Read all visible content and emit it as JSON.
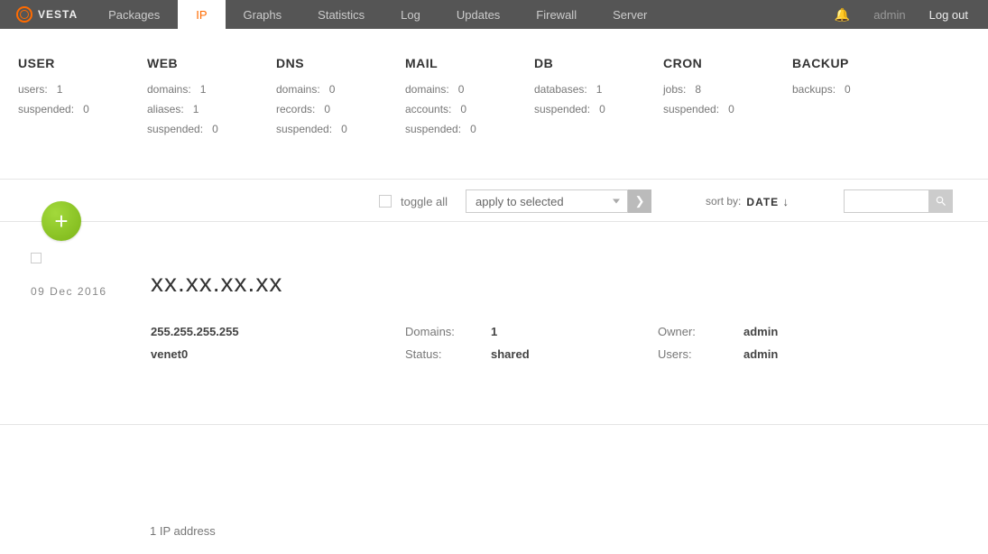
{
  "brand": "VESTA",
  "nav": {
    "items": [
      "Packages",
      "IP",
      "Graphs",
      "Statistics",
      "Log",
      "Updates",
      "Firewall",
      "Server"
    ],
    "active_index": 1
  },
  "topright": {
    "user": "admin",
    "logout": "Log out"
  },
  "stats": [
    {
      "title": "USER",
      "rows": [
        {
          "label": "users:",
          "value": "1"
        },
        {
          "label": "suspended:",
          "value": "0"
        }
      ]
    },
    {
      "title": "WEB",
      "rows": [
        {
          "label": "domains:",
          "value": "1"
        },
        {
          "label": "aliases:",
          "value": "1"
        },
        {
          "label": "suspended:",
          "value": "0"
        }
      ]
    },
    {
      "title": "DNS",
      "rows": [
        {
          "label": "domains:",
          "value": "0"
        },
        {
          "label": "records:",
          "value": "0"
        },
        {
          "label": "suspended:",
          "value": "0"
        }
      ]
    },
    {
      "title": "MAIL",
      "rows": [
        {
          "label": "domains:",
          "value": "0"
        },
        {
          "label": "accounts:",
          "value": "0"
        },
        {
          "label": "suspended:",
          "value": "0"
        }
      ]
    },
    {
      "title": "DB",
      "rows": [
        {
          "label": "databases:",
          "value": "1"
        },
        {
          "label": "suspended:",
          "value": "0"
        }
      ]
    },
    {
      "title": "CRON",
      "rows": [
        {
          "label": "jobs:",
          "value": "8"
        },
        {
          "label": "suspended:",
          "value": "0"
        }
      ]
    },
    {
      "title": "BACKUP",
      "rows": [
        {
          "label": "backups:",
          "value": "0"
        }
      ]
    }
  ],
  "toolbar": {
    "toggle_all": "toggle all",
    "apply_selected": "apply to selected",
    "sort_by": "sort by:",
    "sort_value": "DATE",
    "sort_dir": "↓",
    "search_placeholder": ""
  },
  "item": {
    "date": "09 Dec 2016",
    "ip": "xx.xx.xx.xx",
    "netmask": "255.255.255.255",
    "interface": "venet0",
    "details": {
      "domains_label": "Domains:",
      "domains_value": "1",
      "status_label": "Status:",
      "status_value": "shared",
      "owner_label": "Owner:",
      "owner_value": "admin",
      "users_label": "Users:",
      "users_value": "admin"
    }
  },
  "footer": {
    "count": "1 IP address"
  }
}
